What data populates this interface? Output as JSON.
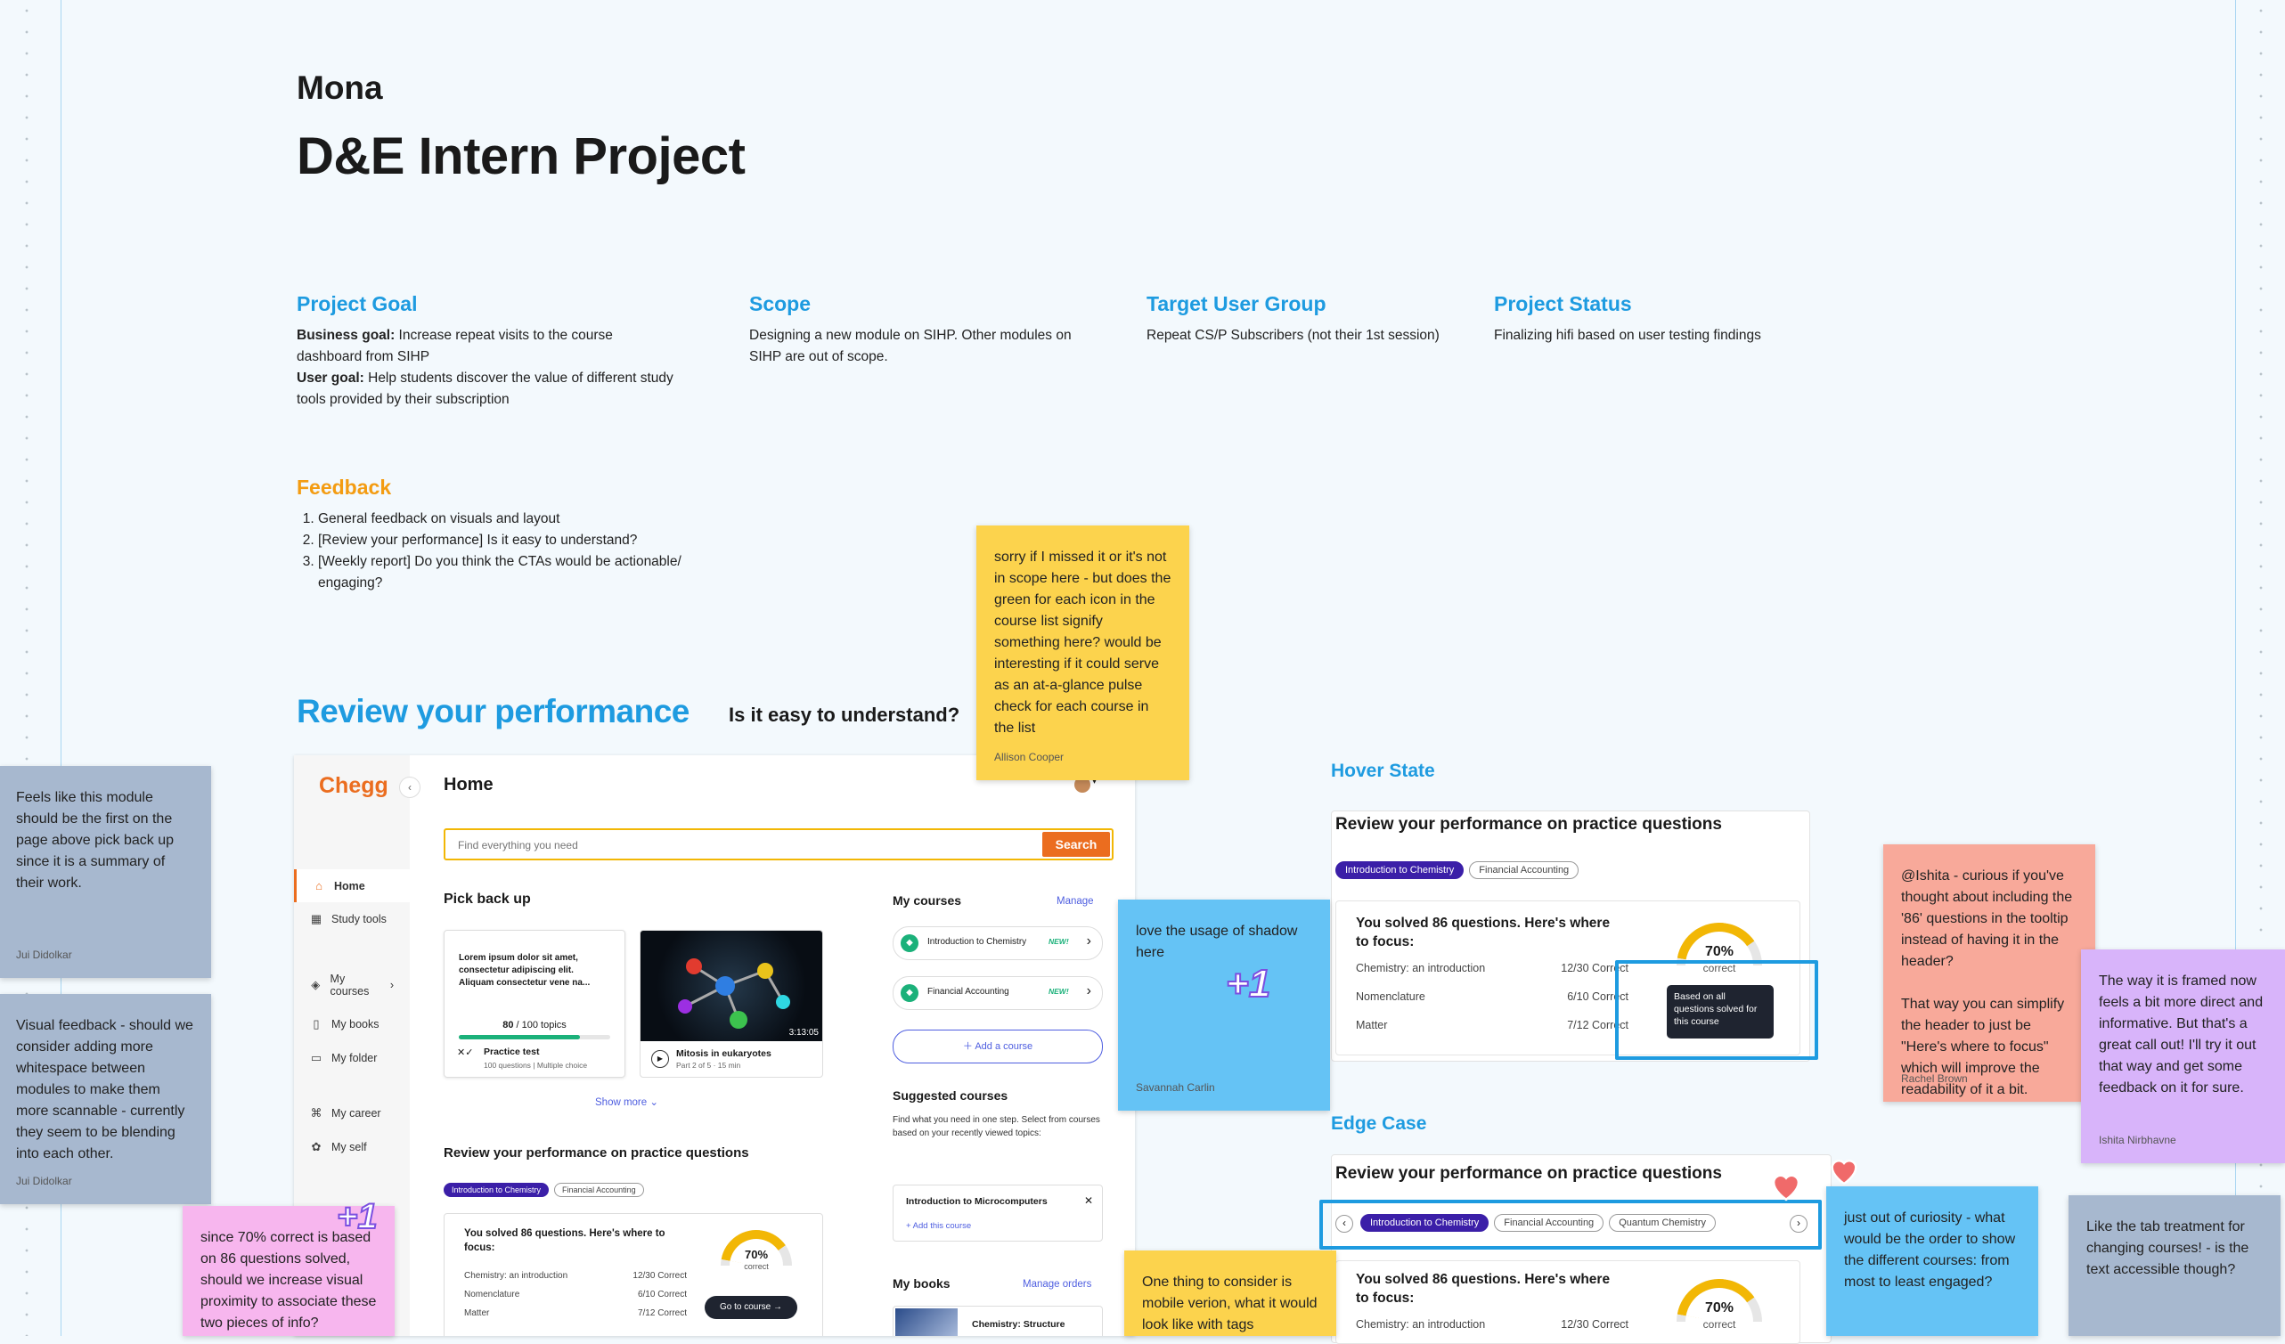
{
  "header": {
    "author": "Mona",
    "title": "D&E Intern Project"
  },
  "sections": [
    {
      "heading": "Project Goal",
      "lines": [
        {
          "bold": "Business goal:",
          "text": " Increase repeat visits to the course dashboard from SIHP"
        },
        {
          "bold": "User goal:",
          "text": " Help students discover the value of different study tools provided by their subscription"
        }
      ]
    },
    {
      "heading": "Scope",
      "text": "Designing a new module on SIHP. Other modules on SIHP are out of scope."
    },
    {
      "heading": "Target User Group",
      "text": "Repeat CS/P Subscribers (not their 1st session)"
    },
    {
      "heading": "Project Status",
      "text": "Finalizing hifi based on user testing findings"
    }
  ],
  "feedback": {
    "heading": "Feedback",
    "items": [
      "General feedback on visuals and layout",
      "[Review your performance] Is it easy to understand?",
      "[Weekly report] Do you think the CTAs would be actionable/ engaging?"
    ]
  },
  "review": {
    "title": "Review your performance",
    "question": "Is it easy to understand?"
  },
  "mock": {
    "logo": "Chegg",
    "page_title": "Home",
    "search_placeholder": "Find everything you need",
    "search_button": "Search",
    "nav": [
      {
        "label": "Home",
        "icon": "home-icon",
        "glyph": "⌂"
      },
      {
        "label": "Study tools",
        "icon": "grid-icon",
        "glyph": "▦"
      },
      {
        "label": "My courses",
        "icon": "layers-icon",
        "glyph": "◈"
      },
      {
        "label": "My books",
        "icon": "book-icon",
        "glyph": "▯"
      },
      {
        "label": "My folder",
        "icon": "folder-icon",
        "glyph": "▭"
      },
      {
        "label": "My career",
        "icon": "career-icon",
        "glyph": "⌘"
      },
      {
        "label": "My self",
        "icon": "self-icon",
        "glyph": "✿"
      }
    ],
    "pick_back_up": "Pick back up",
    "card1": {
      "text": "Lorem ipsum dolor sit amet, consectetur adipiscing elit. Aliquam consectetur vene na...",
      "count_bold": "80",
      "count_rest": " / 100 topics",
      "progress": 0.8,
      "type": "Practice test",
      "meta": "100 questions  |  Multiple choice"
    },
    "card2": {
      "duration": "3:13:05",
      "title": "Mitosis in eukaryotes",
      "meta": "Part 2 of 5  ·  15 min"
    },
    "show_more": "Show more",
    "my_courses": "My courses",
    "manage": "Manage",
    "courses": [
      {
        "name": "Introduction to Chemistry",
        "badge": "NEW!"
      },
      {
        "name": "Financial Accounting",
        "badge": "NEW!"
      }
    ],
    "add_course": "Add a course",
    "suggested": {
      "title": "Suggested courses",
      "text": "Find what you need in one step. Select from courses based on your recently viewed topics:",
      "course": "Introduction to Microcomputers",
      "add": "+ Add this course"
    },
    "my_books": "My books",
    "manage_orders": "Manage orders",
    "book": "Chemistry: Structure",
    "review_title": "Review your performance on practice questions",
    "go_to_course": "Go to course →"
  },
  "perf": {
    "title": "Review your performance on practice questions",
    "tabs": [
      "Introduction to Chemistry",
      "Financial Accounting"
    ],
    "tabs_edge": [
      "Introduction to Chemistry",
      "Financial Accounting",
      "Quantum Chemistry"
    ],
    "solved": "You solved 86 questions. Here's where to focus:",
    "rows": [
      {
        "topic": "Chemistry: an introduction",
        "score": "12/30 Correct"
      },
      {
        "topic": "Nomenclature",
        "score": "6/10 Correct"
      },
      {
        "topic": "Matter",
        "score": "7/12 Correct"
      }
    ],
    "gauge_pct": "70%",
    "gauge_value": 0.7,
    "gauge_label": "correct",
    "tooltip": "Based on all questions solved for this course"
  },
  "hover_state": "Hover State",
  "edge_case": "Edge Case",
  "plus_one": "+1",
  "stickies": [
    {
      "text": "Feels like this module should be the first on the page above pick back up since it is a summary of their work.",
      "author": "Jui Didolkar"
    },
    {
      "text": "Visual feedback - should we consider adding more whitespace between modules to make them more scannable - currently they seem to be blending into each other.",
      "author": "Jui Didolkar"
    },
    {
      "text": "since 70% correct is based on 86 questions solved, should we increase visual proximity to associate these two pieces of info?",
      "author": ""
    },
    {
      "text": "sorry if I missed it or it's not in scope here - but does the green for each icon in the course list signify something here? would be interesting if it could serve as an at-a-glance pulse check for each course in the list",
      "author": "Allison Cooper"
    },
    {
      "text": "love the usage of shadow here",
      "author": "Savannah Carlin"
    },
    {
      "text": "One thing to consider is mobile verion, what it would look like with tags",
      "author": ""
    },
    {
      "text": "@Ishita - curious if you've thought about including the '86' questions in the tooltip instead of having it in the header?\n\nThat way you can simplify the header to just be \"Here's where to focus\" which will improve the readability of it a bit.",
      "author": "Rachel Brown"
    },
    {
      "text": "The way it is framed now feels a bit more direct and informative. But that's a great call out! I'll try it out that way and get some feedback on it for sure.",
      "author": "Ishita Nirbhavne"
    },
    {
      "text": "just out of curiosity - what would be the order to show the different courses: from most to least engaged?",
      "author": ""
    },
    {
      "text": "Like the tab treatment for changing courses! - is the text accessible though?",
      "author": ""
    }
  ],
  "colors": {
    "accent_blue": "#1e9be0",
    "feedback_orange": "#f39c12",
    "chegg_orange": "#eb6d1f",
    "tab_purple": "#3b1fa8",
    "gauge_yellow": "#f2b705"
  }
}
